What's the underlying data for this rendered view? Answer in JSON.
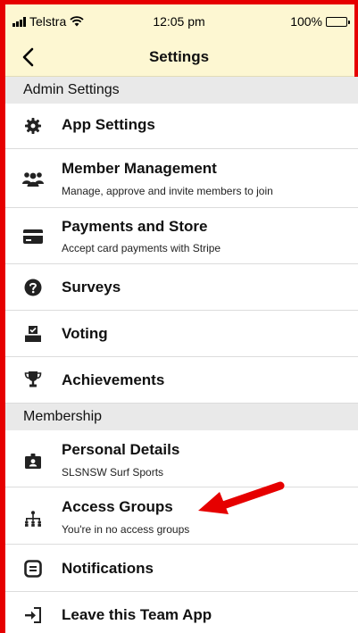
{
  "status_bar": {
    "carrier": "Telstra",
    "time": "12:05 pm",
    "battery": "100%"
  },
  "nav": {
    "title": "Settings"
  },
  "sections": {
    "admin": "Admin Settings",
    "membership": "Membership"
  },
  "items": {
    "app_settings": {
      "title": "App Settings"
    },
    "member_management": {
      "title": "Member Management",
      "subtitle": "Manage, approve and invite members to join"
    },
    "payments_store": {
      "title": "Payments and Store",
      "subtitle": "Accept card payments with Stripe"
    },
    "surveys": {
      "title": "Surveys"
    },
    "voting": {
      "title": "Voting"
    },
    "achievements": {
      "title": "Achievements"
    },
    "personal_details": {
      "title": "Personal Details",
      "subtitle": "SLSNSW Surf Sports"
    },
    "access_groups": {
      "title": "Access Groups",
      "subtitle": "You're in no access groups"
    },
    "notifications": {
      "title": "Notifications"
    },
    "leave": {
      "title": "Leave this Team App"
    }
  },
  "colors": {
    "header_bg": "#fdf7d2",
    "section_bg": "#e9e9e9",
    "annotation_red": "#e60000"
  },
  "icons": {
    "app_settings": "gear-icon",
    "member_management": "people-group-icon",
    "payments_store": "credit-card-icon",
    "surveys": "question-circle-icon",
    "voting": "ballot-box-icon",
    "achievements": "trophy-icon",
    "personal_details": "id-badge-icon",
    "access_groups": "org-chart-icon",
    "notifications": "message-square-icon",
    "leave": "sign-out-icon"
  }
}
